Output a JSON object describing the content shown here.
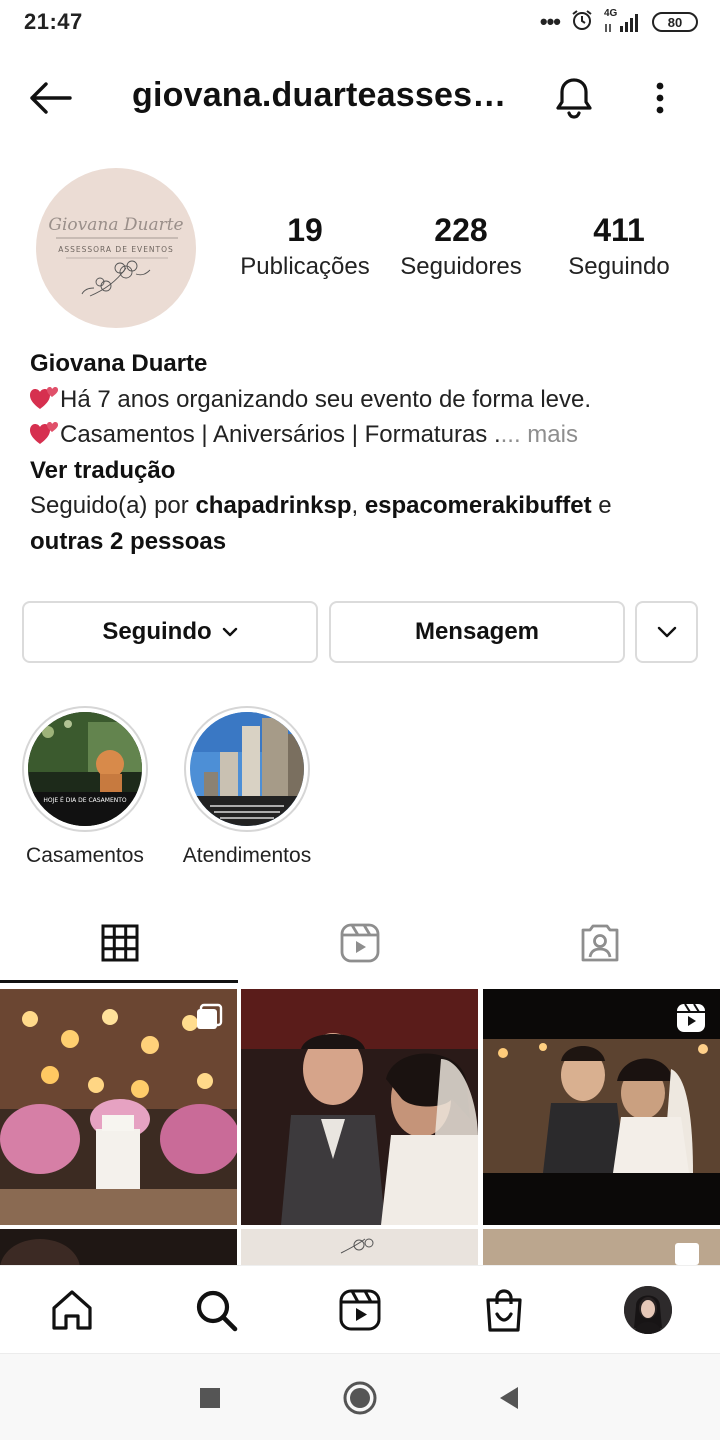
{
  "status_bar": {
    "time": "21:47",
    "network": "4G",
    "battery": "80",
    "overflow_dots": "•••"
  },
  "header": {
    "username": "giovana.duarteassessoria"
  },
  "profile": {
    "avatar_logo_script": "Giovana Duarte",
    "avatar_logo_subtitle": "ASSESSORA DE EVENTOS",
    "stats": [
      {
        "value": "19",
        "label": "Publicações"
      },
      {
        "value": "228",
        "label": "Seguidores"
      },
      {
        "value": "411",
        "label": "Seguindo"
      }
    ]
  },
  "bio": {
    "name": "Giovana Duarte",
    "line1": "Há 7 anos organizando seu evento de forma leve.",
    "line2": "Casamentos | Aniversários | Formaturas .",
    "more": "... mais",
    "translate": "Ver tradução",
    "followed_prefix": "Seguido(a) por ",
    "follower1": "chapadrinksp",
    "comma": ", ",
    "follower2": "espacomerakibuffet",
    "and": " e",
    "others": "outras 2 pessoas"
  },
  "actions": {
    "following_label": "Seguindo",
    "message_label": "Mensagem"
  },
  "highlights": [
    {
      "label": "Casamentos",
      "overlay": "HOJE É DIA DE CASAMENTO"
    },
    {
      "label": "Atendimentos"
    }
  ],
  "tabs": [
    "grid-icon",
    "reels-icon",
    "tagged-icon"
  ],
  "nav": [
    "home-icon",
    "search-icon",
    "reels-icon",
    "shop-icon",
    "profile-avatar"
  ],
  "colors": {
    "text": "#262626",
    "muted": "#8e8e8e",
    "border": "#dbdbdb",
    "heart": "#d6304f",
    "avatar_bg": "#ebdcd4"
  }
}
